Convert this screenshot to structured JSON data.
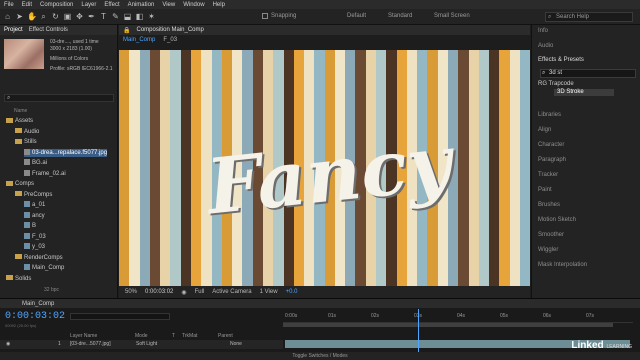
{
  "menubar": [
    "File",
    "Edit",
    "Composition",
    "Layer",
    "Effect",
    "Animation",
    "View",
    "Window",
    "Help"
  ],
  "toolbar": {
    "snapping": "Snapping",
    "workspaces": [
      "Default",
      "Standard",
      "Small Screen"
    ],
    "search_placeholder": "Search Help"
  },
  "project": {
    "tabs": [
      "Project",
      "Effect Controls"
    ],
    "selected_file": "03-drea...repalace.f5077.jpg",
    "file_info": [
      "03-dre...., used 1 time",
      "3000 x 2183 (1.00)",
      "Millions of Colors",
      "Profile: sRGB IEC61966-2.1"
    ],
    "tree": [
      {
        "label": "Assets",
        "kind": "folder",
        "indent": 0
      },
      {
        "label": "Audio",
        "kind": "folder",
        "indent": 1
      },
      {
        "label": "Stills",
        "kind": "folder",
        "indent": 1
      },
      {
        "label": "03-drea...repalace.f5077.jpg",
        "kind": "file",
        "indent": 2,
        "selected": true
      },
      {
        "label": "BG.ai",
        "kind": "file",
        "indent": 2
      },
      {
        "label": "Frame_02.ai",
        "kind": "file",
        "indent": 2
      },
      {
        "label": "Comps",
        "kind": "folder",
        "indent": 0
      },
      {
        "label": "PreComps",
        "kind": "folder",
        "indent": 1
      },
      {
        "label": "a_01",
        "kind": "comp",
        "indent": 2
      },
      {
        "label": "ancy",
        "kind": "comp",
        "indent": 2
      },
      {
        "label": "B",
        "kind": "comp",
        "indent": 2
      },
      {
        "label": "F_03",
        "kind": "comp",
        "indent": 2
      },
      {
        "label": "y_03",
        "kind": "comp",
        "indent": 2
      },
      {
        "label": "RenderComps",
        "kind": "folder",
        "indent": 1
      },
      {
        "label": "Main_Comp",
        "kind": "comp",
        "indent": 2
      },
      {
        "label": "Solids",
        "kind": "folder",
        "indent": 0
      }
    ],
    "bpc": "32 bpc"
  },
  "viewer": {
    "tab": "Composition Main_Comp",
    "subtabs": [
      "Main_Comp",
      "F_03"
    ],
    "title_text": "Fancy",
    "stripe_colors": [
      "#d99b35",
      "#f1e5c8",
      "#8ba9b6",
      "#6a4a32",
      "#e8d3a9",
      "#b1c8c9",
      "#4c3424",
      "#e7a43b",
      "#efe2c3",
      "#93b8c3"
    ],
    "zoom": "50%",
    "time": "0:00:03:02",
    "resolution": "Full",
    "camera": "Active Camera",
    "views": "1 View",
    "offset": "+0.0"
  },
  "right_panel": {
    "items": [
      "Info",
      "Audio"
    ],
    "effects_header": "Effects & Presets",
    "effects_search": "3d st",
    "category": "RG Trapcode",
    "effect": "3D Stroke",
    "panels": [
      "Libraries",
      "Align",
      "Character",
      "Paragraph",
      "Tracker",
      "Paint",
      "Brushes",
      "Motion Sketch",
      "Smoother",
      "Wiggler",
      "Mask Interpolation"
    ]
  },
  "timeline": {
    "tab": "Main_Comp",
    "timecode": "0:00:03:02",
    "fps": "00092 (25.00 fps)",
    "columns": [
      "Layer Name",
      "Mode",
      "T",
      "TrkMat",
      "Parent"
    ],
    "layer": {
      "index": "1",
      "name": "[03-dre...5077.jpg]",
      "mode": "Soft Light",
      "parent": "None"
    },
    "ruler_ticks": [
      "0:00s",
      "01s",
      "02s",
      "03s",
      "04s",
      "05s",
      "06s",
      "07s"
    ],
    "toggle_label": "Toggle Switches / Modes"
  },
  "brand": {
    "name": "Linked",
    "sub": "LEARNING"
  }
}
